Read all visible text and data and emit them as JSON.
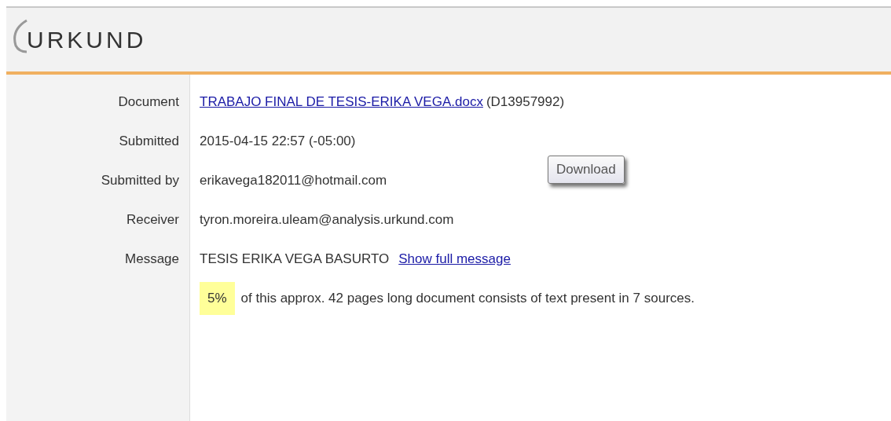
{
  "logo": {
    "text": "URKUND"
  },
  "details": [
    {
      "label": "Document",
      "kind": "document",
      "link": "TRABAJO FINAL DE TESIS-ERIKA VEGA.docx",
      "value": "(D13957992)"
    },
    {
      "label": "Submitted",
      "kind": "text",
      "value": "2015-04-15 22:57 (-05:00)"
    },
    {
      "label": "Submitted by",
      "kind": "text",
      "value": "erikavega182011@hotmail.com"
    },
    {
      "label": "Receiver",
      "kind": "text",
      "value": "tyron.moreira.uleam@analysis.urkund.com"
    },
    {
      "label": "Message",
      "kind": "message",
      "value": "TESIS ERIKA VEGA BASURTO",
      "link": "Show full message"
    }
  ],
  "download_button": "Download",
  "summary": {
    "percent": "5%",
    "text": "of this approx. 42 pages long document consists of text present in 7 sources."
  }
}
